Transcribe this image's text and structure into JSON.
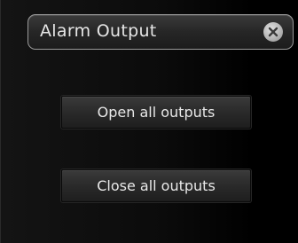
{
  "dialog": {
    "title": "Alarm Output",
    "close_icon": "close-icon",
    "buttons": {
      "open_all": "Open all outputs",
      "close_all": "Close all outputs"
    }
  },
  "colors": {
    "background": "#050505",
    "button_text": "#e8e8e8",
    "title_border": "#9a9a9a",
    "close_icon_bg": "#b6b6b6"
  }
}
